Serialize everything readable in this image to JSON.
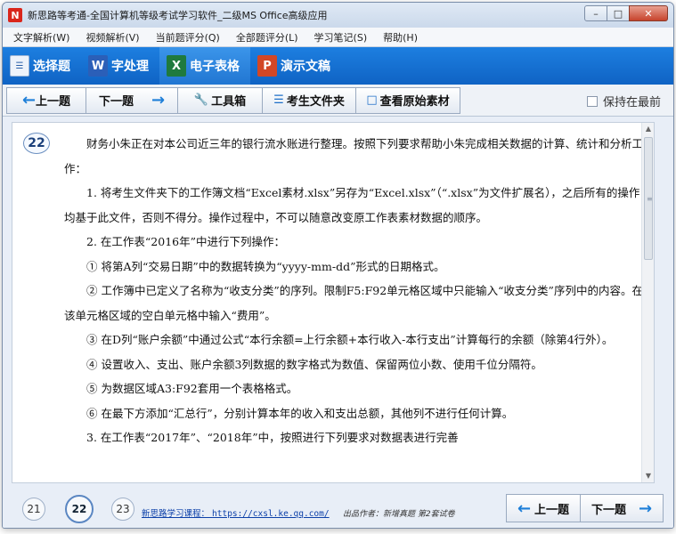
{
  "window": {
    "title": "新思路等考通-全国计算机等级考试学习软件_二级MS Office高级应用",
    "app_icon": "N",
    "controls": [
      "minimize",
      "maximize",
      "close"
    ]
  },
  "menu": [
    "文字解析(W)",
    "视频解析(V)",
    "当前题评分(Q)",
    "全部题评分(L)",
    "学习笔记(S)",
    "帮助(H)"
  ],
  "modules": [
    {
      "label": "选择题",
      "icon": "document-icon"
    },
    {
      "label": "字处理",
      "icon": "word-icon",
      "badge": "W"
    },
    {
      "label": "电子表格",
      "icon": "excel-icon",
      "badge": "X"
    },
    {
      "label": "演示文稿",
      "icon": "powerpoint-icon",
      "badge": "P"
    }
  ],
  "navbar": {
    "prev": "上一题",
    "next": "下一题",
    "toolbox": "工具箱",
    "examinee_folder": "考生文件夹",
    "view_original": "查看原始素材",
    "keep_on_top": "保持在最前"
  },
  "question": {
    "number": "22",
    "paragraphs": [
      "财务小朱正在对本公司近三年的银行流水账进行整理。按照下列要求帮助小朱完成相关数据的计算、统计和分析工作：",
      "1. 将考生文件夹下的工作簿文档“Excel素材.xlsx”另存为“Excel.xlsx”（“.xlsx”为文件扩展名），之后所有的操作均基于此文件，否则不得分。操作过程中，不可以随意改变原工作表素材数据的顺序。",
      "2. 在工作表“2016年”中进行下列操作：",
      "① 将第A列“交易日期”中的数据转换为“yyyy-mm-dd”形式的日期格式。",
      "② 工作簿中已定义了名称为“收支分类”的序列。限制F5:F92单元格区域中只能输入“收支分类”序列中的内容。在该单元格区域的空白单元格中输入“费用”。",
      "③ 在D列“账户余额”中通过公式“本行余额=上行余额+本行收入-本行支出”计算每行的余额（除第4行外）。",
      "④ 设置收入、支出、账户余额3列数据的数字格式为数值、保留两位小数、使用千位分隔符。",
      "⑤ 为数据区域A3:F92套用一个表格格式。",
      "⑥ 在最下方添加“汇总行”，分别计算本年的收入和支出总额，其他列不进行任何计算。",
      "3. 在工作表“2017年”、“2018年”中，按照进行下列要求对数据表进行完善"
    ]
  },
  "bottom": {
    "question_numbers": [
      "21",
      "22",
      "23"
    ],
    "current": "22",
    "course_label": "新思路学习课程：",
    "course_url": "https://cxsl.ke.qq.com/",
    "author": "出品作者：新增真题 第2套试卷",
    "prev": "上一题",
    "next": "下一题"
  },
  "colors": {
    "module_bar": "#1670d6",
    "accent_arrow": "#1e7fd8",
    "link": "#0b3fa8"
  }
}
